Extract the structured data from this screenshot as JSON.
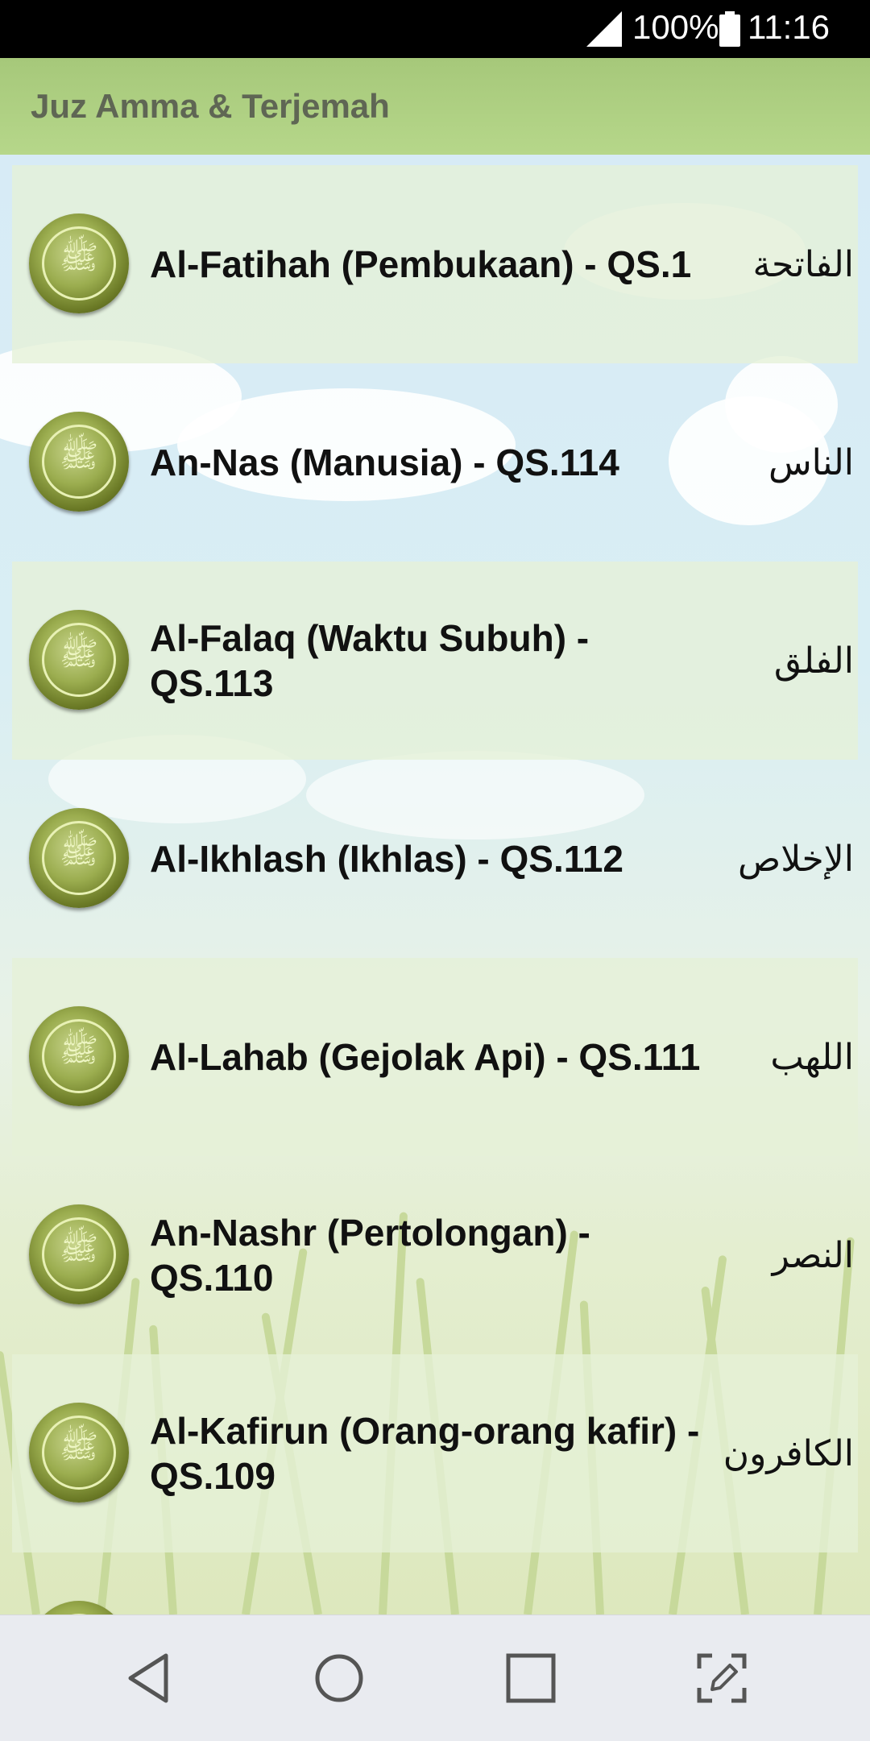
{
  "status": {
    "battery": "100%",
    "time": "11:16"
  },
  "app": {
    "title": "Juz Amma & Terjemah"
  },
  "surahs": [
    {
      "name": "Al-Fatihah (Pembukaan) - QS.1",
      "arabic": "الفاتحة",
      "shaded": true
    },
    {
      "name": "An-Nas (Manusia) - QS.114",
      "arabic": "الناس",
      "shaded": false
    },
    {
      "name": "Al-Falaq (Waktu Subuh) - QS.113",
      "arabic": "الفلق",
      "shaded": true
    },
    {
      "name": "Al-Ikhlash (Ikhlas) - QS.112",
      "arabic": "الإخلاص",
      "shaded": false
    },
    {
      "name": "Al-Lahab (Gejolak Api) - QS.111",
      "arabic": "اللهب",
      "shaded": true
    },
    {
      "name": "An-Nashr (Pertolongan) - QS.110",
      "arabic": "النصر",
      "shaded": false
    },
    {
      "name": "Al-Kafirun (Orang-orang kafir) - QS.109",
      "arabic": "الكافرون",
      "shaded": true
    }
  ],
  "icons": {
    "surah": "quran-medallion-icon",
    "back": "back-icon",
    "home": "home-icon",
    "recents": "recents-icon",
    "edit": "screenshot-edit-icon"
  }
}
